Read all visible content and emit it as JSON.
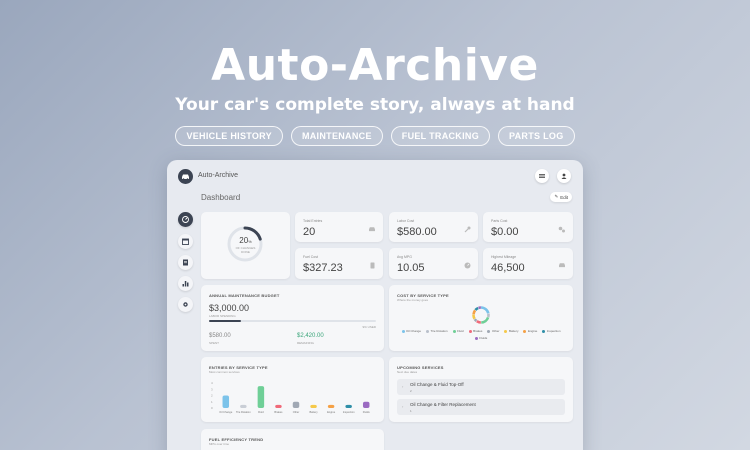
{
  "hero": {
    "title": "Auto-Archive",
    "subtitle": "Your car's complete story, always at hand",
    "pills": [
      "VEHICLE HISTORY",
      "MAINTENANCE",
      "FUEL TRACKING",
      "PARTS LOG"
    ]
  },
  "app": {
    "name": "Auto-Archive",
    "page_title": "Dashboard",
    "edit_label": "Edit",
    "nav_icons": [
      "dashboard-icon",
      "calendar-icon",
      "document-icon",
      "chart-icon",
      "settings-icon"
    ]
  },
  "progress": {
    "percent_label": "20",
    "percent_sign": "%",
    "caption_1": "OF CHANGES",
    "caption_2": "DONE",
    "value": 0.2
  },
  "stats": [
    {
      "label": "Total Entries",
      "value": "20",
      "icon": "car-icon"
    },
    {
      "label": "Labor Cost",
      "value": "$580.00",
      "icon": "wrench-icon"
    },
    {
      "label": "Parts Cost",
      "value": "$0.00",
      "icon": "gears-icon"
    },
    {
      "label": "Fuel Cost",
      "value": "$327.23",
      "icon": "fuel-icon"
    },
    {
      "label": "Avg MPG",
      "value": "10.05",
      "icon": "gauge-icon"
    },
    {
      "label": "Highest Mileage",
      "value": "46,500",
      "icon": "car-icon"
    }
  ],
  "budget": {
    "title": "ANNUAL MAINTENANCE BUDGET",
    "amount": "$3,000.00",
    "amount_caption": "LABOR SPENDING",
    "fill": 0.19,
    "fill_caption": "9% USED",
    "spent": "$580.00",
    "spent_caption": "SPENT",
    "remaining": "$2,420.00",
    "remaining_caption": "REMAINING"
  },
  "cost_by_type": {
    "title": "COST BY SERVICE TYPE",
    "subtitle": "Where the money goes",
    "legend": [
      {
        "name": "Oil Change",
        "color": "#7cc3ea"
      },
      {
        "name": "Tire Rotation",
        "color": "#b9c0cb"
      },
      {
        "name": "Fluid",
        "color": "#6fcf97"
      },
      {
        "name": "Brakes",
        "color": "#f06a7a"
      },
      {
        "name": "Other",
        "color": "#a0a8b4"
      },
      {
        "name": "Battery",
        "color": "#f5c94a"
      },
      {
        "name": "Engine",
        "color": "#f5a146"
      },
      {
        "name": "Inspection",
        "color": "#2f8fa8"
      },
      {
        "name": "Fluids",
        "color": "#9b6bc2"
      }
    ],
    "slices": [
      0.22,
      0.08,
      0.2,
      0.1,
      0.06,
      0.1,
      0.1,
      0.08,
      0.06
    ]
  },
  "entries_by_type": {
    "title": "ENTRIES BY SERVICE TYPE",
    "subtitle": "Most common services",
    "y_ticks": [
      "4",
      "3",
      "2",
      "1",
      "0"
    ],
    "categories": [
      "Oil Change",
      "Tire Rotation",
      "Fluid",
      "Brakes",
      "Other",
      "Battery",
      "Engine",
      "Inspection",
      "Fluids"
    ],
    "values": [
      2,
      0.5,
      3.5,
      0.5,
      1,
      0.5,
      0.5,
      0.5,
      1
    ],
    "colors": [
      "#7cc3ea",
      "#c9ced6",
      "#6fcf97",
      "#f06a7a",
      "#a0a8b4",
      "#f5c94a",
      "#f5a146",
      "#2f8fa8",
      "#9b6bc2"
    ]
  },
  "upcoming": {
    "title": "UPCOMING SERVICES",
    "subtitle": "Next due dates",
    "items": [
      {
        "name": "Oil Change & Fluid Top-Off",
        "num": "2"
      },
      {
        "name": "Oil Change & Filter Replacement",
        "num": "1"
      }
    ]
  },
  "fuel": {
    "title": "FUEL EFFICIENCY TREND",
    "subtitle": "MPG over time"
  }
}
